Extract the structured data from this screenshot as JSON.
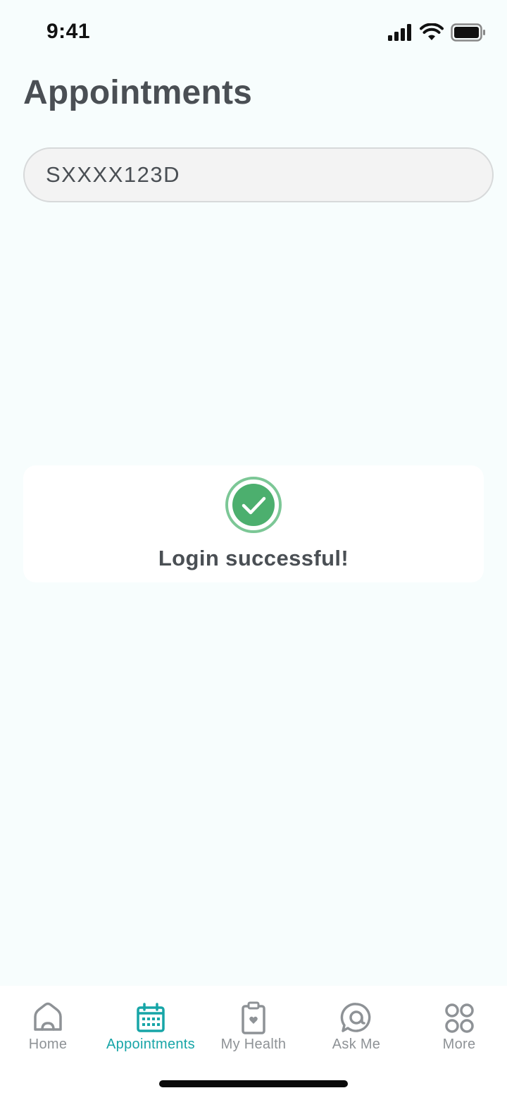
{
  "status_bar": {
    "time": "9:41"
  },
  "page": {
    "title": "Appointments"
  },
  "id_field": {
    "value": "SXXXX123D"
  },
  "toast": {
    "message": "Login successful!",
    "icon": "check-circle-icon",
    "color": "#4caf6e"
  },
  "nav": {
    "active_color": "#17a5a7",
    "inactive_color": "#8e9296",
    "items": [
      {
        "label": "Home",
        "icon": "home-icon"
      },
      {
        "label": "Appointments",
        "icon": "calendar-icon"
      },
      {
        "label": "My Health",
        "icon": "clipboard-heart-icon"
      },
      {
        "label": "Ask Me",
        "icon": "chat-bubble-icon"
      },
      {
        "label": "More",
        "icon": "grid-icon"
      }
    ]
  }
}
